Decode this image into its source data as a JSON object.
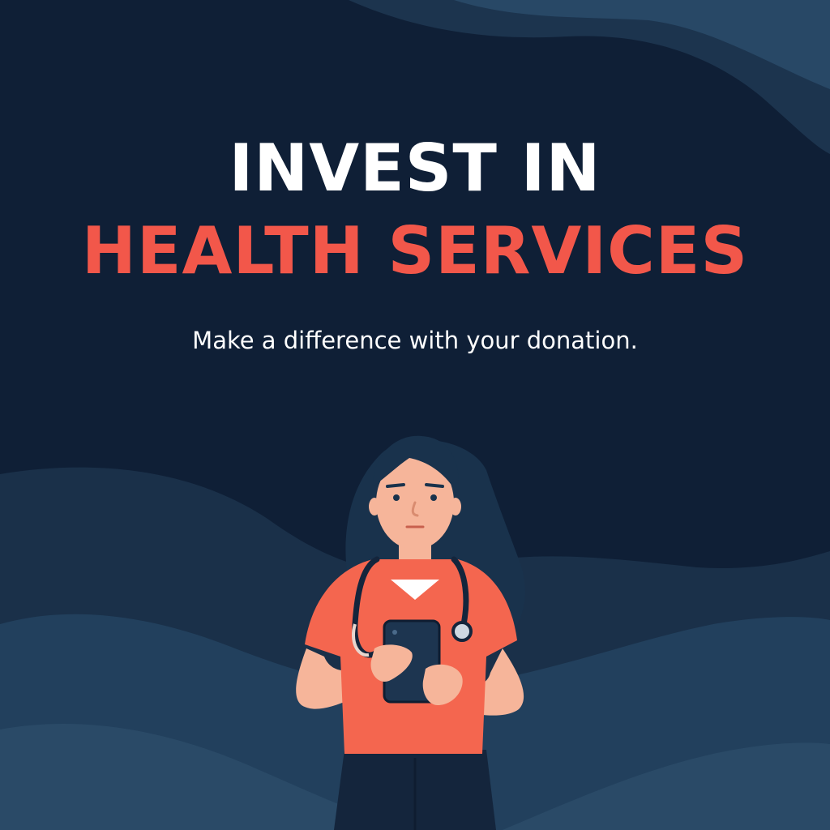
{
  "headline": {
    "line1": "INVEST IN",
    "line2": "HEALTH SERVICES"
  },
  "tagline": "Make a difference with your donation.",
  "colors": {
    "background": "#0f1f36",
    "wave_dark": "#1a3049",
    "wave_mid": "#22405d",
    "wave_light": "#2a4a67",
    "headline_primary": "#ffffff",
    "headline_accent": "#f2574a",
    "tagline": "#ffffff",
    "scrubs": "#f4664f",
    "skin": "#f6b59a",
    "hair": "#19324c",
    "pants": "#14253c",
    "tablet": "#1d3550"
  },
  "illustration": {
    "subject": "healthcare-worker",
    "items": [
      "stethoscope-icon",
      "tablet-icon"
    ]
  }
}
